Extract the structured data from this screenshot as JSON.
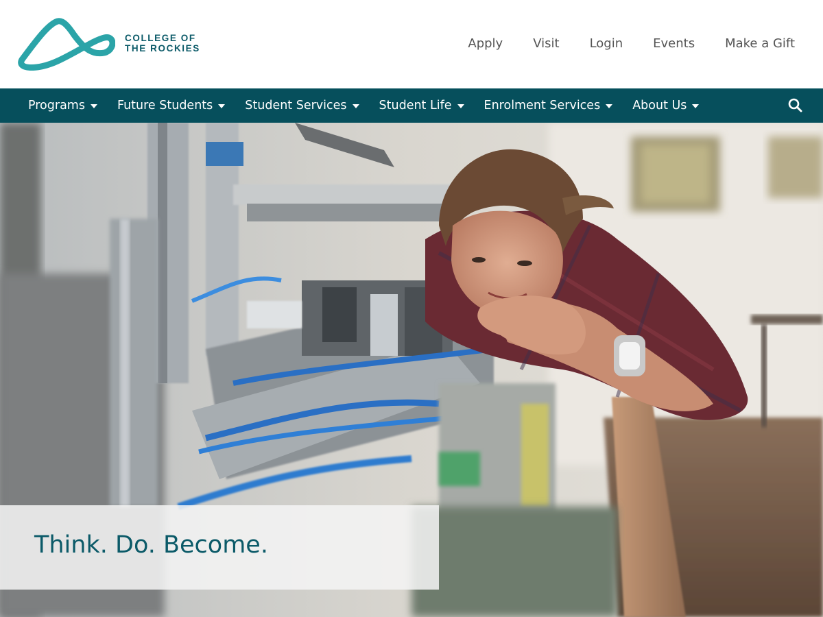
{
  "brand": {
    "name_line1": "COLLEGE OF",
    "name_line2": "THE ROCKIES",
    "color": "#2ba4a8",
    "text_color": "#0b5a68"
  },
  "utility_nav": {
    "items": [
      "Apply",
      "Visit",
      "Login",
      "Events",
      "Make a Gift"
    ]
  },
  "main_nav": {
    "background": "#064f5c",
    "items": [
      {
        "label": "Programs",
        "icon": "chevron-down-icon"
      },
      {
        "label": "Future Students",
        "icon": "chevron-down-icon"
      },
      {
        "label": "Student Services",
        "icon": "chevron-down-icon"
      },
      {
        "label": "Student Life",
        "icon": "chevron-down-icon"
      },
      {
        "label": "Enrolment Services",
        "icon": "chevron-down-icon"
      },
      {
        "label": "About Us",
        "icon": "chevron-down-icon"
      }
    ],
    "search_icon": "search-icon"
  },
  "hero": {
    "tagline": "Think. Do. Become."
  }
}
